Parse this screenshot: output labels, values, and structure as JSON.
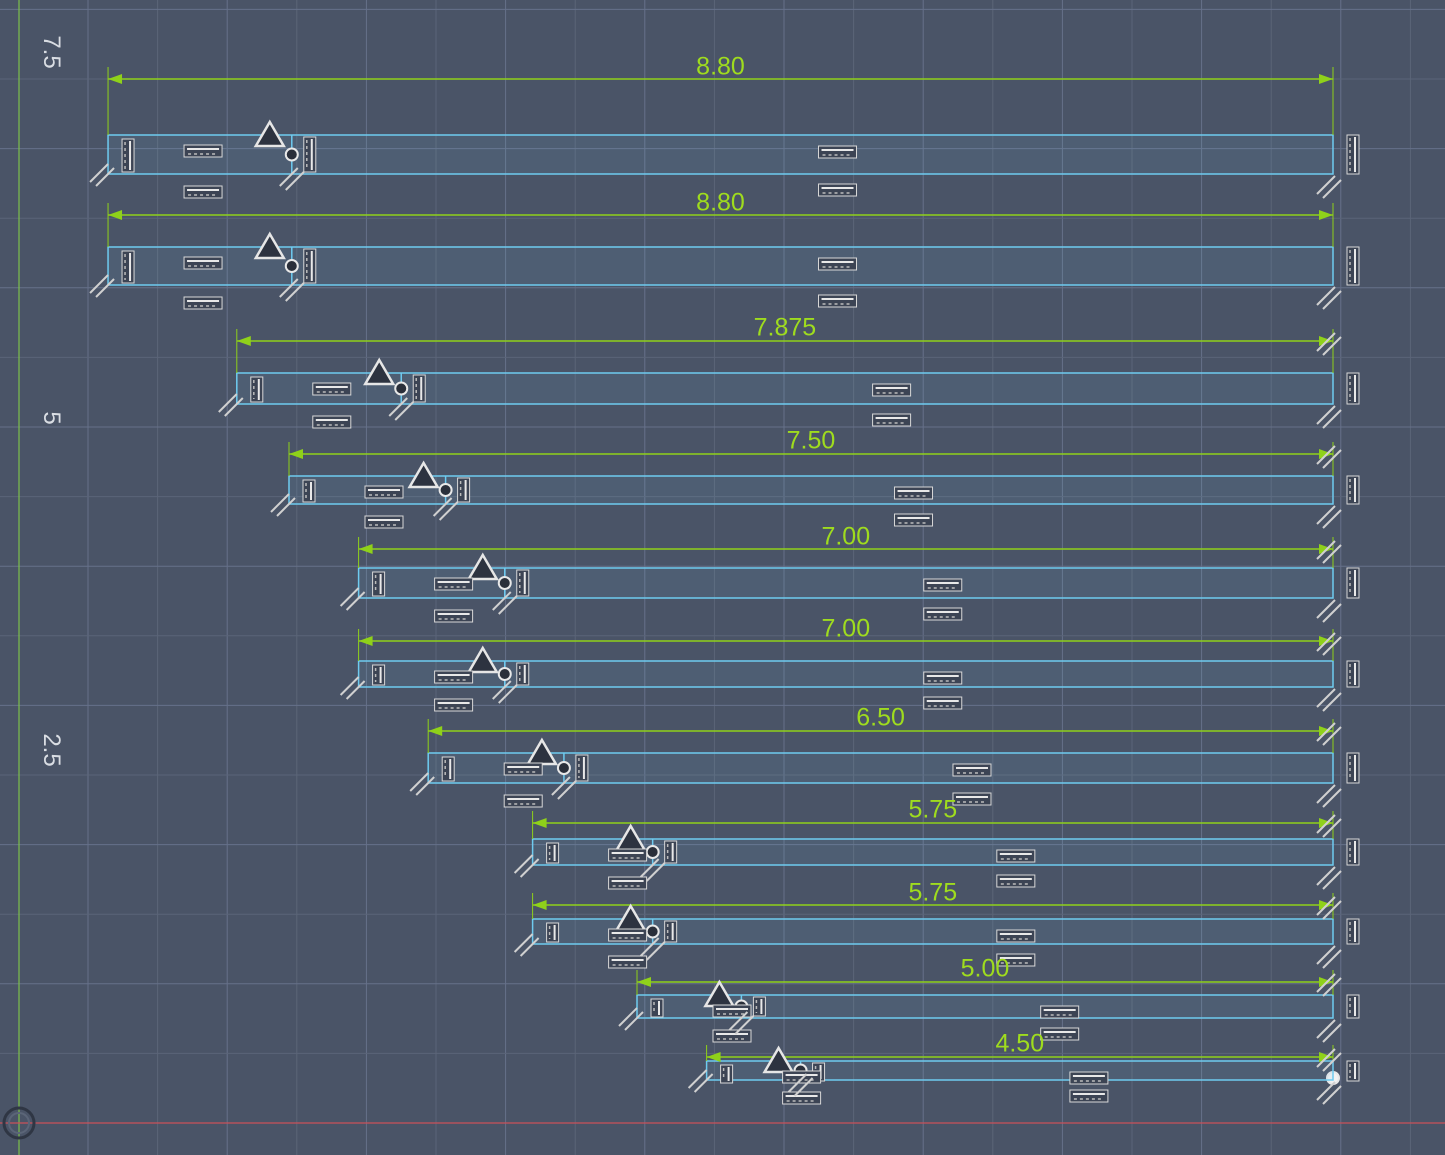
{
  "viewport": {
    "background": "#4a5467",
    "grid_minor_color": "#5b6578",
    "grid_major_color": "#66718a",
    "axis_y_color": "#7cc04a",
    "axis_x_color": "#c9505a"
  },
  "ruler": {
    "labels": [
      "7.5",
      "5",
      "2.5"
    ]
  },
  "colors": {
    "dimension": "#8fd11a",
    "body_outline": "#6ecbf0",
    "body_fill": "rgba(120,190,230,0.10)",
    "constraint_icon": "#e6e6e6"
  },
  "sketch_rows": [
    {
      "dimension": "8.80",
      "length": 8.8
    },
    {
      "dimension": "8.80",
      "length": 8.8
    },
    {
      "dimension": "7.875",
      "length": 7.875
    },
    {
      "dimension": "7.50",
      "length": 7.5
    },
    {
      "dimension": "7.00",
      "length": 7.0
    },
    {
      "dimension": "7.00",
      "length": 7.0
    },
    {
      "dimension": "6.50",
      "length": 6.5
    },
    {
      "dimension": "5.75",
      "length": 5.75
    },
    {
      "dimension": "5.75",
      "length": 5.75
    },
    {
      "dimension": "5.00",
      "length": 5.0
    },
    {
      "dimension": "4.50",
      "length": 4.5
    }
  ],
  "icons": {
    "origin": "origin-icon",
    "triangle_constraint": "triangle-constraint-icon",
    "horizontal_constraint": "horizontal-constraint-icon",
    "vertical_constraint": "vertical-constraint-icon",
    "coincident_point": "coincident-point-icon",
    "parallel_constraint": "parallel-constraint-icon"
  }
}
